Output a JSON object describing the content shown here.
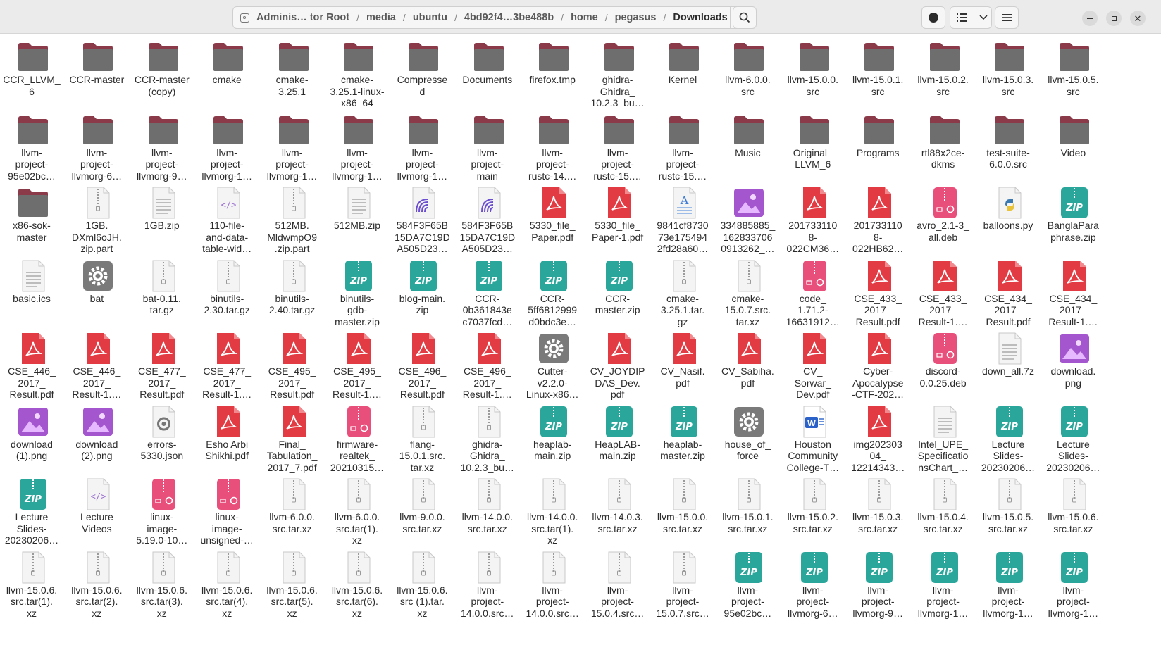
{
  "header": {
    "path": [
      "Adminis… tor Root",
      "media",
      "ubuntu",
      "4bd92f4…3be488b",
      "home",
      "pegasus",
      "Downloads"
    ]
  },
  "colors": {
    "folder": "#6e6e6e",
    "folder_tab": "#8b3a4a",
    "pdf": "#e23b43",
    "zip": "#2aa69b",
    "deb": "#e84f7a",
    "image": "#a456cf"
  },
  "files": [
    {
      "name": "CCR_LLVM_\n6",
      "icon": "folder"
    },
    {
      "name": "CCR-master",
      "icon": "folder"
    },
    {
      "name": "CCR-master\n(copy)",
      "icon": "folder"
    },
    {
      "name": "cmake",
      "icon": "folder"
    },
    {
      "name": "cmake-\n3.25.1",
      "icon": "folder"
    },
    {
      "name": "cmake-\n3.25.1-linux-\nx86_64",
      "icon": "folder"
    },
    {
      "name": "Compresse\nd",
      "icon": "folder"
    },
    {
      "name": "Documents",
      "icon": "folder"
    },
    {
      "name": "firefox.tmp",
      "icon": "folder"
    },
    {
      "name": "ghidra-\nGhidra_\n10.2.3_bu…",
      "icon": "folder"
    },
    {
      "name": "Kernel",
      "icon": "folder"
    },
    {
      "name": "llvm-6.0.0.\nsrc",
      "icon": "folder"
    },
    {
      "name": "llvm-15.0.0.\nsrc",
      "icon": "folder"
    },
    {
      "name": "llvm-15.0.1.\nsrc",
      "icon": "folder"
    },
    {
      "name": "llvm-15.0.2.\nsrc",
      "icon": "folder"
    },
    {
      "name": "llvm-15.0.3.\nsrc",
      "icon": "folder"
    },
    {
      "name": "llvm-15.0.5.\nsrc",
      "icon": "folder"
    },
    {
      "name": "llvm-\nproject-\n95e02bc…",
      "icon": "folder"
    },
    {
      "name": "llvm-\nproject-\nllvmorg-6…",
      "icon": "folder"
    },
    {
      "name": "llvm-\nproject-\nllvmorg-9…",
      "icon": "folder"
    },
    {
      "name": "llvm-\nproject-\nllvmorg-1…",
      "icon": "folder"
    },
    {
      "name": "llvm-\nproject-\nllvmorg-1…",
      "icon": "folder"
    },
    {
      "name": "llvm-\nproject-\nllvmorg-1…",
      "icon": "folder"
    },
    {
      "name": "llvm-\nproject-\nllvmorg-1…",
      "icon": "folder"
    },
    {
      "name": "llvm-\nproject-\nmain",
      "icon": "folder"
    },
    {
      "name": "llvm-\nproject-\nrustc-14.…",
      "icon": "folder"
    },
    {
      "name": "llvm-\nproject-\nrustc-15.…",
      "icon": "folder"
    },
    {
      "name": "llvm-\nproject-\nrustc-15.…",
      "icon": "folder"
    },
    {
      "name": "Music",
      "icon": "folder"
    },
    {
      "name": "Original_\nLLVM_6",
      "icon": "folder"
    },
    {
      "name": "Programs",
      "icon": "folder"
    },
    {
      "name": "rtl88x2ce-\ndkms",
      "icon": "folder"
    },
    {
      "name": "test-suite-\n6.0.0.src",
      "icon": "folder"
    },
    {
      "name": "Video",
      "icon": "folder"
    },
    {
      "name": "x86-sok-\nmaster",
      "icon": "folder"
    },
    {
      "name": "1GB.\nDXml6oJH.\nzip.part",
      "icon": "archive"
    },
    {
      "name": "1GB.zip",
      "icon": "text"
    },
    {
      "name": "110-file-\nand-data-\ntable-wid…",
      "icon": "html"
    },
    {
      "name": "512MB.\nMldwmpO9\n.zip.part",
      "icon": "archive"
    },
    {
      "name": "512MB.zip",
      "icon": "text"
    },
    {
      "name": "584F3F65B\n15DA7C19D\nA505D23…",
      "icon": "swirl"
    },
    {
      "name": "584F3F65B\n15DA7C19D\nA505D23…",
      "icon": "swirl"
    },
    {
      "name": "5330_file_\nPaper.pdf",
      "icon": "pdf"
    },
    {
      "name": "5330_file_\nPaper-1.pdf",
      "icon": "pdf"
    },
    {
      "name": "9841cf8730\n73e175494\n2fd28a60…",
      "icon": "doc-text"
    },
    {
      "name": "334885885_\n162833706\n0913262_…",
      "icon": "image"
    },
    {
      "name": "201733110\n8-\n022CM36…",
      "icon": "pdf"
    },
    {
      "name": "201733110\n8-\n022HB62…",
      "icon": "pdf"
    },
    {
      "name": "avro_2.1-3_\nall.deb",
      "icon": "deb"
    },
    {
      "name": "balloons.py",
      "icon": "python"
    },
    {
      "name": "BanglaPara\nphrase.zip",
      "icon": "zip"
    },
    {
      "name": "basic.ics",
      "icon": "text"
    },
    {
      "name": "bat",
      "icon": "gear"
    },
    {
      "name": "bat-0.11.\ntar.gz",
      "icon": "archive"
    },
    {
      "name": "binutils-\n2.30.tar.gz",
      "icon": "archive"
    },
    {
      "name": "binutils-\n2.40.tar.gz",
      "icon": "archive"
    },
    {
      "name": "binutils-\ngdb-\nmaster.zip",
      "icon": "zip"
    },
    {
      "name": "blog-main.\nzip",
      "icon": "zip"
    },
    {
      "name": "CCR-\n0b361843e\nc7037fcd…",
      "icon": "zip"
    },
    {
      "name": "CCR-\n5ff6812999\nd0bdc3e…",
      "icon": "zip"
    },
    {
      "name": "CCR-\nmaster.zip",
      "icon": "zip"
    },
    {
      "name": "cmake-\n3.25.1.tar.\ngz",
      "icon": "archive"
    },
    {
      "name": "cmake-\n15.0.7.src.\ntar.xz",
      "icon": "archive"
    },
    {
      "name": "code_\n1.71.2-\n16631912…",
      "icon": "deb"
    },
    {
      "name": "CSE_433_\n2017_\nResult.pdf",
      "icon": "pdf"
    },
    {
      "name": "CSE_433_\n2017_\nResult-1.…",
      "icon": "pdf"
    },
    {
      "name": "CSE_434_\n2017_\nResult.pdf",
      "icon": "pdf"
    },
    {
      "name": "CSE_434_\n2017_\nResult-1.…",
      "icon": "pdf"
    },
    {
      "name": "CSE_446_\n2017_\nResult.pdf",
      "icon": "pdf"
    },
    {
      "name": "CSE_446_\n2017_\nResult-1.…",
      "icon": "pdf"
    },
    {
      "name": "CSE_477_\n2017_\nResult.pdf",
      "icon": "pdf"
    },
    {
      "name": "CSE_477_\n2017_\nResult-1.…",
      "icon": "pdf"
    },
    {
      "name": "CSE_495_\n2017_\nResult.pdf",
      "icon": "pdf"
    },
    {
      "name": "CSE_495_\n2017_\nResult-1.…",
      "icon": "pdf"
    },
    {
      "name": "CSE_496_\n2017_\nResult.pdf",
      "icon": "pdf"
    },
    {
      "name": "CSE_496_\n2017_\nResult-1.…",
      "icon": "pdf"
    },
    {
      "name": "Cutter-\nv2.2.0-\nLinux-x86…",
      "icon": "gear"
    },
    {
      "name": "CV_JOYDIP\nDAS_Dev.\npdf",
      "icon": "pdf"
    },
    {
      "name": "CV_Nasif.\npdf",
      "icon": "pdf"
    },
    {
      "name": "CV_Sabiha.\npdf",
      "icon": "pdf"
    },
    {
      "name": "CV_\nSorwar_\nDev.pdf",
      "icon": "pdf"
    },
    {
      "name": "Cyber-\nApocalypse\n-CTF-202…",
      "icon": "pdf"
    },
    {
      "name": "discord-\n0.0.25.deb",
      "icon": "deb"
    },
    {
      "name": "down_all.7z",
      "icon": "text"
    },
    {
      "name": "download.\npng",
      "icon": "image"
    },
    {
      "name": "download\n(1).png",
      "icon": "image"
    },
    {
      "name": "download\n(2).png",
      "icon": "image"
    },
    {
      "name": "errors-\n5330.json",
      "icon": "json"
    },
    {
      "name": "Esho Arbi\nShikhi.pdf",
      "icon": "pdf"
    },
    {
      "name": "Final_\nTabulation_\n2017_7.pdf",
      "icon": "pdf"
    },
    {
      "name": "firmware-\nrealtek_\n20210315…",
      "icon": "deb"
    },
    {
      "name": "flang-\n15.0.1.src.\ntar.xz",
      "icon": "archive"
    },
    {
      "name": "ghidra-\nGhidra_\n10.2.3_bu…",
      "icon": "archive"
    },
    {
      "name": "heaplab-\nmain.zip",
      "icon": "zip"
    },
    {
      "name": "HeapLAB-\nmain.zip",
      "icon": "zip"
    },
    {
      "name": "heaplab-\nmaster.zip",
      "icon": "zip"
    },
    {
      "name": "house_of_\nforce",
      "icon": "gear"
    },
    {
      "name": "Houston\nCommunity\nCollege-T…",
      "icon": "word"
    },
    {
      "name": "img202303\n04_\n12214343…",
      "icon": "pdf"
    },
    {
      "name": "Intel_UPE_\nSpecificatio\nnsChart_…",
      "icon": "text"
    },
    {
      "name": "Lecture\nSlides-\n20230206…",
      "icon": "zip"
    },
    {
      "name": "Lecture\nSlides-\n20230206…",
      "icon": "zip"
    },
    {
      "name": "Lecture\nSlides-\n20230206…",
      "icon": "zip"
    },
    {
      "name": "Lecture\nVideos",
      "icon": "html"
    },
    {
      "name": "linux-\nimage-\n5.19.0-10…",
      "icon": "deb"
    },
    {
      "name": "linux-\nimage-\nunsigned-…",
      "icon": "deb"
    },
    {
      "name": "llvm-6.0.0.\nsrc.tar.xz",
      "icon": "archive"
    },
    {
      "name": "llvm-6.0.0.\nsrc.tar(1).\nxz",
      "icon": "archive"
    },
    {
      "name": "llvm-9.0.0.\nsrc.tar.xz",
      "icon": "archive"
    },
    {
      "name": "llvm-14.0.0.\nsrc.tar.xz",
      "icon": "archive"
    },
    {
      "name": "llvm-14.0.0.\nsrc.tar(1).\nxz",
      "icon": "archive"
    },
    {
      "name": "llvm-14.0.3.\nsrc.tar.xz",
      "icon": "archive"
    },
    {
      "name": "llvm-15.0.0.\nsrc.tar.xz",
      "icon": "archive"
    },
    {
      "name": "llvm-15.0.1.\nsrc.tar.xz",
      "icon": "archive"
    },
    {
      "name": "llvm-15.0.2.\nsrc.tar.xz",
      "icon": "archive"
    },
    {
      "name": "llvm-15.0.3.\nsrc.tar.xz",
      "icon": "archive"
    },
    {
      "name": "llvm-15.0.4.\nsrc.tar.xz",
      "icon": "archive"
    },
    {
      "name": "llvm-15.0.5.\nsrc.tar.xz",
      "icon": "archive"
    },
    {
      "name": "llvm-15.0.6.\nsrc.tar.xz",
      "icon": "archive"
    },
    {
      "name": "llvm-15.0.6.\nsrc.tar(1).\nxz",
      "icon": "archive"
    },
    {
      "name": "llvm-15.0.6.\nsrc.tar(2).\nxz",
      "icon": "archive"
    },
    {
      "name": "llvm-15.0.6.\nsrc.tar(3).\nxz",
      "icon": "archive"
    },
    {
      "name": "llvm-15.0.6.\nsrc.tar(4).\nxz",
      "icon": "archive"
    },
    {
      "name": "llvm-15.0.6.\nsrc.tar(5).\nxz",
      "icon": "archive"
    },
    {
      "name": "llvm-15.0.6.\nsrc.tar(6).\nxz",
      "icon": "archive"
    },
    {
      "name": "llvm-15.0.6.\nsrc (1).tar.\nxz",
      "icon": "archive"
    },
    {
      "name": "llvm-\nproject-\n14.0.0.src…",
      "icon": "archive"
    },
    {
      "name": "llvm-\nproject-\n14.0.0.src…",
      "icon": "archive"
    },
    {
      "name": "llvm-\nproject-\n15.0.4.src…",
      "icon": "archive"
    },
    {
      "name": "llvm-\nproject-\n15.0.7.src…",
      "icon": "archive"
    },
    {
      "name": "llvm-\nproject-\n95e02bc…",
      "icon": "zip"
    },
    {
      "name": "llvm-\nproject-\nllvmorg-6…",
      "icon": "zip"
    },
    {
      "name": "llvm-\nproject-\nllvmorg-9…",
      "icon": "zip"
    },
    {
      "name": "llvm-\nproject-\nllvmorg-1…",
      "icon": "zip"
    },
    {
      "name": "llvm-\nproject-\nllvmorg-1…",
      "icon": "zip"
    },
    {
      "name": "llvm-\nproject-\nllvmorg-1…",
      "icon": "zip"
    }
  ]
}
